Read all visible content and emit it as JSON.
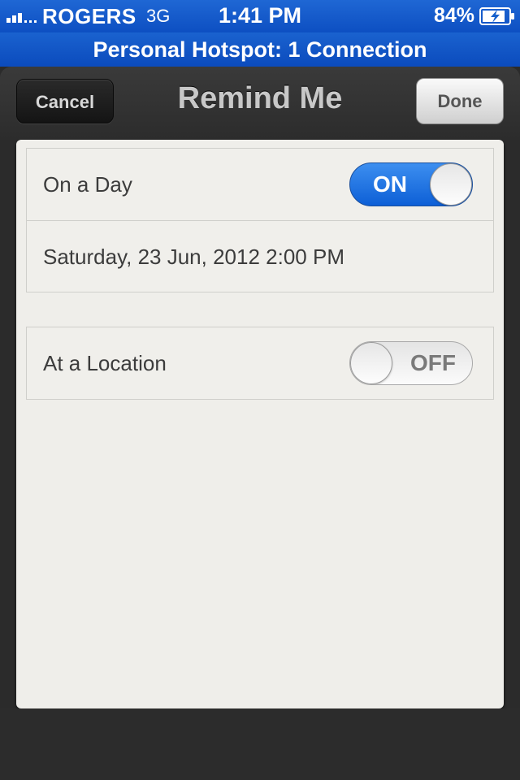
{
  "status_bar": {
    "carrier": "ROGERS",
    "network": "3G",
    "time": "1:41 PM",
    "battery_percent": "84%",
    "signal_icon": "signal-bars-icon",
    "battery_icon": "battery-charging-icon"
  },
  "hotspot_banner": {
    "text": "Personal Hotspot: 1 Connection",
    "color": "#1560cc"
  },
  "nav": {
    "title": "Remind Me",
    "cancel_label": "Cancel",
    "done_label": "Done"
  },
  "groups": [
    {
      "rows": [
        {
          "label": "On a Day",
          "switch": {
            "state": "on",
            "text": "ON"
          }
        },
        {
          "label": "Saturday, 23 Jun, 2012 2:00 PM"
        }
      ]
    },
    {
      "rows": [
        {
          "label": "At a Location",
          "switch": {
            "state": "off",
            "text": "OFF"
          }
        }
      ]
    }
  ],
  "colors": {
    "accent_blue": "#1a6fe3",
    "paper": "#efeeea",
    "leather": "#2c2c2c"
  }
}
